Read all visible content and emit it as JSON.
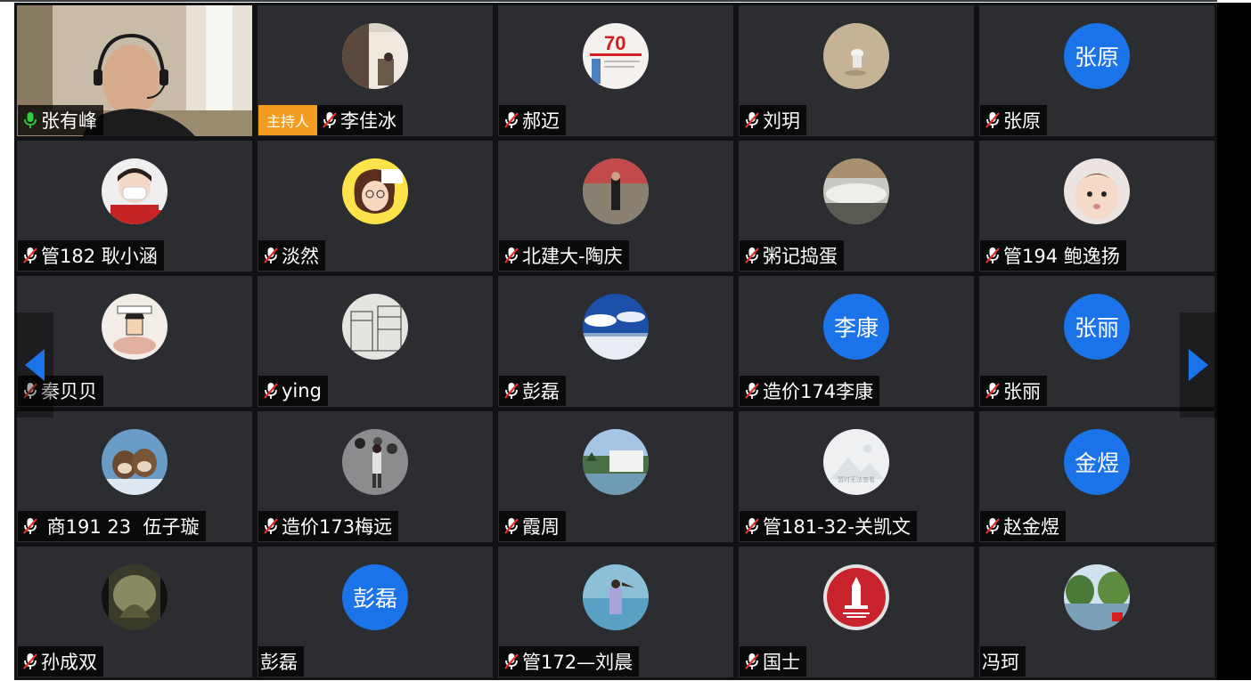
{
  "colors": {
    "tile_bg": "#2b2d31",
    "grid_bg": "#111214",
    "avatar_blue": "#1a73e8",
    "host_badge": "#f29d1f",
    "nav_arrow": "#1a73e8",
    "mic_active": "#2ecc40",
    "mic_muted": "#ffffff"
  },
  "host_label": "主持人",
  "participants": [
    {
      "name": "张有峰",
      "mic": "active",
      "avatar": "video"
    },
    {
      "name": "李佳冰",
      "mic": "muted",
      "avatar": "photo",
      "photo": "room",
      "host": true
    },
    {
      "name": "郝迈",
      "mic": "muted",
      "avatar": "photo",
      "photo": "poster70"
    },
    {
      "name": "刘玥",
      "mic": "muted",
      "avatar": "photo",
      "photo": "sand"
    },
    {
      "name": "张原",
      "mic": "muted",
      "avatar": "text",
      "avatar_text": "张原"
    },
    {
      "name": "管182 耿小涵",
      "mic": "muted",
      "avatar": "photo",
      "photo": "mask"
    },
    {
      "name": "淡然",
      "mic": "muted",
      "avatar": "photo",
      "photo": "cartoon"
    },
    {
      "name": "北建大-陶庆",
      "mic": "muted",
      "avatar": "photo",
      "photo": "person"
    },
    {
      "name": "粥记捣蛋",
      "mic": "muted",
      "avatar": "photo",
      "photo": "mist"
    },
    {
      "name": "管194 鲍逸扬",
      "mic": "muted",
      "avatar": "photo",
      "photo": "baby"
    },
    {
      "name": "秦贝贝",
      "mic": "muted",
      "avatar": "photo",
      "photo": "drawing"
    },
    {
      "name": "ying",
      "mic": "muted",
      "avatar": "photo",
      "photo": "sketch"
    },
    {
      "name": "彭磊",
      "mic": "muted",
      "avatar": "photo",
      "photo": "sky"
    },
    {
      "name": "造价174李康",
      "mic": "muted",
      "avatar": "text",
      "avatar_text": "李康"
    },
    {
      "name": "张丽",
      "mic": "muted",
      "avatar": "text",
      "avatar_text": "张丽"
    },
    {
      "name": " 商191 23  伍子璇",
      "mic": "muted",
      "avatar": "photo",
      "photo": "otters"
    },
    {
      "name": "造价173梅远",
      "mic": "muted",
      "avatar": "photo",
      "photo": "girl"
    },
    {
      "name": "霞周",
      "mic": "muted",
      "avatar": "photo",
      "photo": "lake"
    },
    {
      "name": "管181-32-关凯文",
      "mic": "muted",
      "avatar": "photo",
      "photo": "placeholder",
      "photo_caption": "暂时无法查看"
    },
    {
      "name": "赵金煜",
      "mic": "muted",
      "avatar": "text",
      "avatar_text": "金煜"
    },
    {
      "name": "孙成双",
      "mic": "muted",
      "avatar": "photo",
      "photo": "film"
    },
    {
      "name": "彭磊",
      "mic": "none",
      "avatar": "text",
      "avatar_text": "彭磊"
    },
    {
      "name": "管172—刘晨",
      "mic": "muted",
      "avatar": "photo",
      "photo": "sea"
    },
    {
      "name": "国士",
      "mic": "muted",
      "avatar": "photo",
      "photo": "redbadge"
    },
    {
      "name": "冯珂",
      "mic": "none",
      "avatar": "photo",
      "photo": "trees"
    }
  ],
  "nav": {
    "prev_icon": "chevron-left-icon",
    "next_icon": "chevron-right-icon"
  }
}
